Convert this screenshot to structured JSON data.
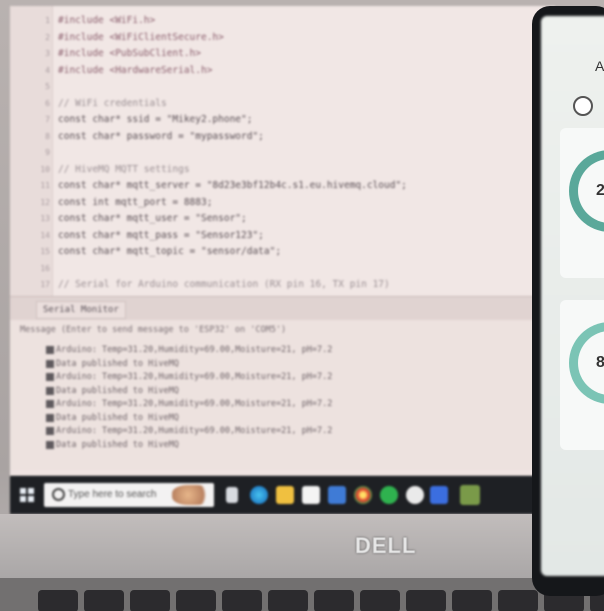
{
  "code": {
    "lines": [
      {
        "n": "1",
        "text": "#include <WiFi.h>"
      },
      {
        "n": "2",
        "text": "#include <WiFiClientSecure.h>"
      },
      {
        "n": "3",
        "text": "#include <PubSubClient.h>"
      },
      {
        "n": "4",
        "text": "#include <HardwareSerial.h>"
      },
      {
        "n": "5",
        "text": ""
      },
      {
        "n": "6",
        "text": "// WiFi credentials"
      },
      {
        "n": "7",
        "text": "const char* ssid = \"Mikey2.phone\";"
      },
      {
        "n": "8",
        "text": "const char* password = \"mypassword\";"
      },
      {
        "n": "9",
        "text": ""
      },
      {
        "n": "10",
        "text": "// HiveMQ MQTT settings"
      },
      {
        "n": "11",
        "text": "const char* mqtt_server = \"8d23e3bf12b4c.s1.eu.hivemq.cloud\";"
      },
      {
        "n": "12",
        "text": "const int mqtt_port = 8883;"
      },
      {
        "n": "13",
        "text": "const char* mqtt_user = \"Sensor\";"
      },
      {
        "n": "14",
        "text": "const char* mqtt_pass = \"Sensor123\";"
      },
      {
        "n": "15",
        "text": "const char* mqtt_topic = \"sensor/data\";"
      },
      {
        "n": "16",
        "text": ""
      },
      {
        "n": "17",
        "text": "// Serial for Arduino communication (RX pin 16, TX pin 17)"
      }
    ]
  },
  "serial_monitor": {
    "tab_label": "Serial Monitor",
    "header": "Message (Enter to send message to 'ESP32' on 'COM5')",
    "rows": [
      "Arduino: Temp=31.20,Humidity=69.00,Moisture=21, pH=7.2",
      "Data published to HiveMQ",
      "Arduino: Temp=31.20,Humidity=69.00,Moisture=21, pH=7.2",
      "Data published to HiveMQ",
      "Arduino: Temp=31.20,Humidity=69.00,Moisture=21, pH=7.2",
      "Data published to HiveMQ",
      "Arduino: Temp=31.20,Humidity=69.00,Moisture=21, pH=7.2",
      "Data published to HiveMQ"
    ]
  },
  "taskbar": {
    "search_placeholder": "Type here to search"
  },
  "brand": {
    "logo_text": "DELL"
  },
  "phone": {
    "header_letter": "A",
    "gauge1_value": "2",
    "gauge2_value": "8"
  },
  "colors": {
    "screen_bg": "#efe4e2",
    "taskbar": "#1e2024",
    "gauge": "#5aa89a"
  }
}
